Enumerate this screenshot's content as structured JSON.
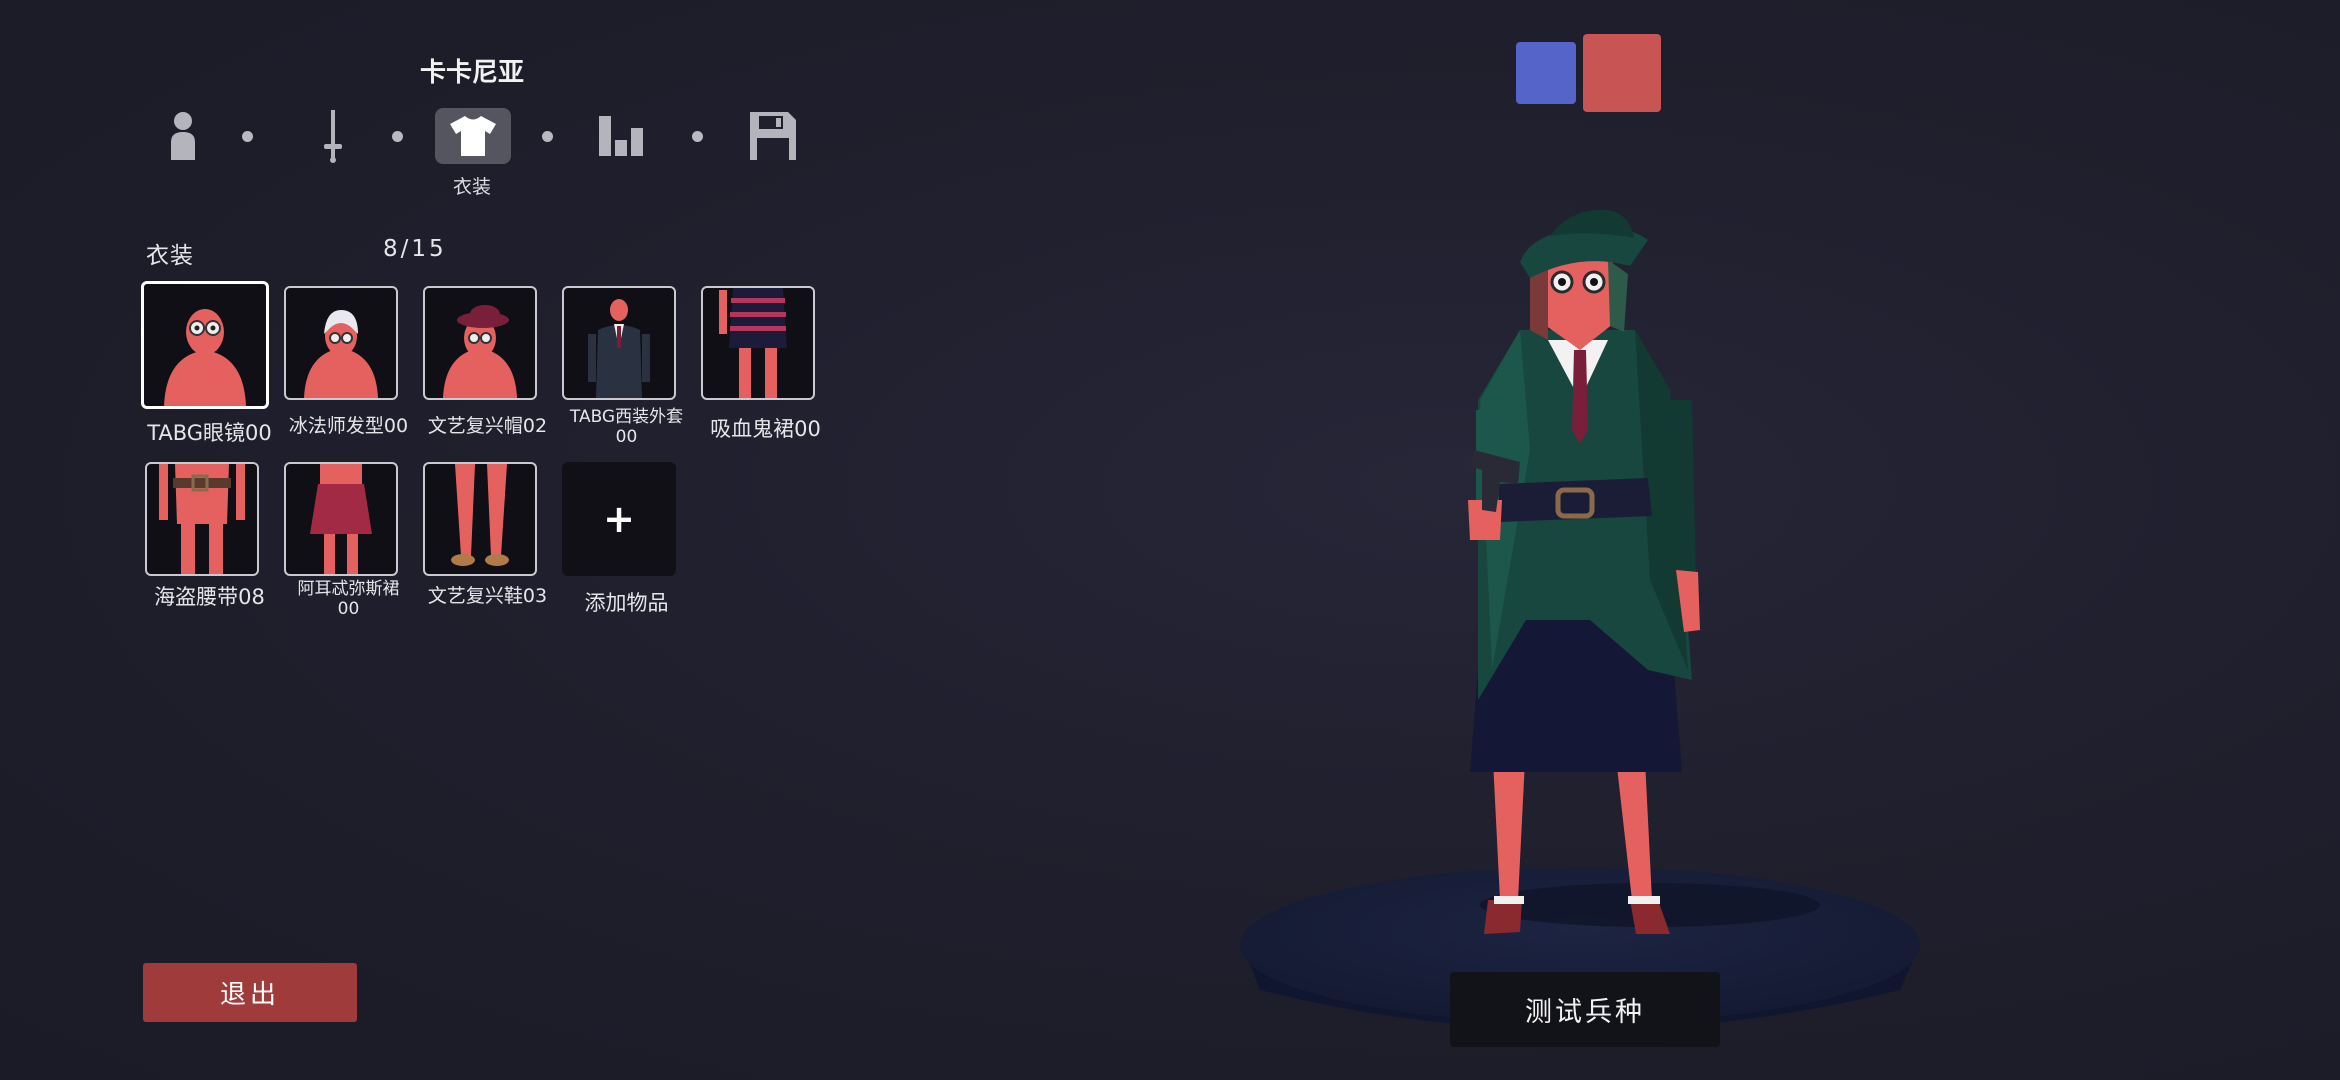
{
  "unit_name": "卡卡尼亚",
  "steps": [
    {
      "icon": "person-icon",
      "label": ""
    },
    {
      "icon": "sword-icon",
      "label": ""
    },
    {
      "icon": "shirt-icon",
      "label": "衣装",
      "active": true
    },
    {
      "icon": "stats-icon",
      "label": ""
    },
    {
      "icon": "save-icon",
      "label": ""
    }
  ],
  "section": {
    "title": "衣装",
    "count": "8/15"
  },
  "items": [
    {
      "label": "TABG眼镜00",
      "selected": true
    },
    {
      "label": "冰法师发型00"
    },
    {
      "label": "文艺复兴帽02"
    },
    {
      "label_line1": "TABG西装外套",
      "label_line2": "00"
    },
    {
      "label": "吸血鬼裙00"
    },
    {
      "label": "海盗腰带08"
    },
    {
      "label_line1": "阿耳忒弥斯裙",
      "label_line2": "00"
    },
    {
      "label": "文艺复兴鞋03"
    },
    {
      "label": "添加物品",
      "add": true
    }
  ],
  "buttons": {
    "exit": "退出",
    "test": "测试兵种"
  },
  "colors": {
    "team_blue": "#5564c8",
    "team_red": "#c85454",
    "exit_bg": "#a03b3b",
    "skin": "#e5615f",
    "coat": "#17473e"
  }
}
